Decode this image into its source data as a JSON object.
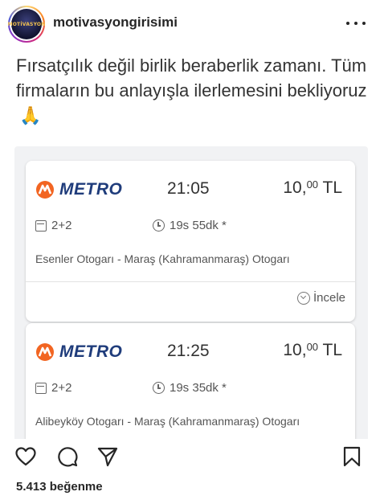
{
  "header": {
    "username": "motivasyongirisimi",
    "avatar_logo": "MOTİVASYON"
  },
  "post": {
    "caption": "Fırsatçılık değil birlik beraberlik zamanı. Tüm firmaların bu anlayışla ilerlemesini bekliyoruz",
    "emoji": "🙏",
    "cards": [
      {
        "brand": "METRO",
        "time": "21:05",
        "price_main": "10,",
        "price_dec": "00",
        "price_unit": " TL",
        "seat": "2+2",
        "duration": "19s 55dk *",
        "route": "Esenler Otogarı - Maraş (Kahramanmaraş) Otogarı",
        "details_label": "İncele"
      },
      {
        "brand": "METRO",
        "time": "21:25",
        "price_main": "10,",
        "price_dec": "00",
        "price_unit": " TL",
        "seat": "2+2",
        "duration": "19s 35dk *",
        "route": "Alibeyköy Otogarı - Maraş (Kahramanmaraş) Otogarı"
      }
    ]
  },
  "actions": {
    "icons": [
      "heart-icon",
      "comment-icon",
      "share-icon",
      "bookmark-icon"
    ]
  },
  "likes": "5.413 beğenme",
  "colors": {
    "brand_orange": "#f26522",
    "brand_navy": "#1f3c7b"
  }
}
